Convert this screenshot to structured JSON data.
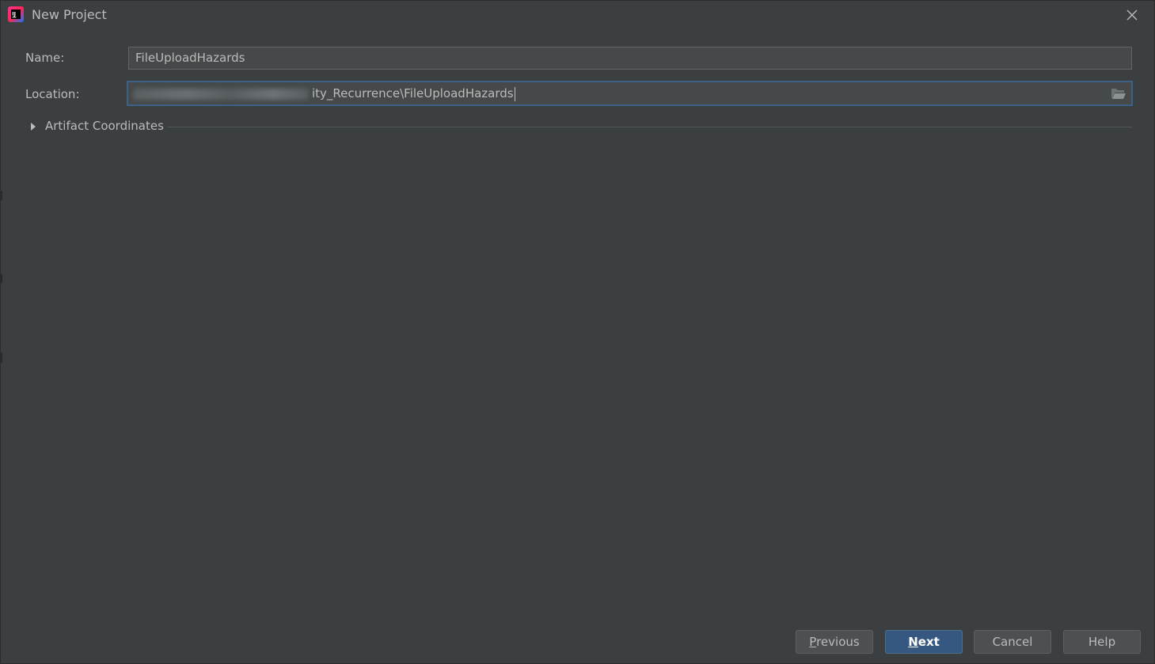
{
  "window": {
    "title": "New Project",
    "app_icon": "intellij-idea-icon",
    "close_icon": "close-icon"
  },
  "form": {
    "name_label": "Name:",
    "name_value": "FileUploadHazards",
    "location_label": "Location:",
    "location_visible_suffix": "ity_Recurrence\\FileUploadHazards",
    "browse_icon": "folder-open-icon"
  },
  "artifact": {
    "label": "Artifact Coordinates",
    "expand_icon": "triangle-right-icon",
    "expanded": false
  },
  "buttons": {
    "previous_mnemonic": "P",
    "previous_rest": "revious",
    "next_mnemonic": "N",
    "next_rest": "ext",
    "cancel": "Cancel",
    "help": "Help"
  },
  "colors": {
    "background": "#3c3f41",
    "field_background": "#45494a",
    "focus_border": "#3d6185",
    "primary_button": "#365880",
    "text": "#bbbbbb"
  }
}
